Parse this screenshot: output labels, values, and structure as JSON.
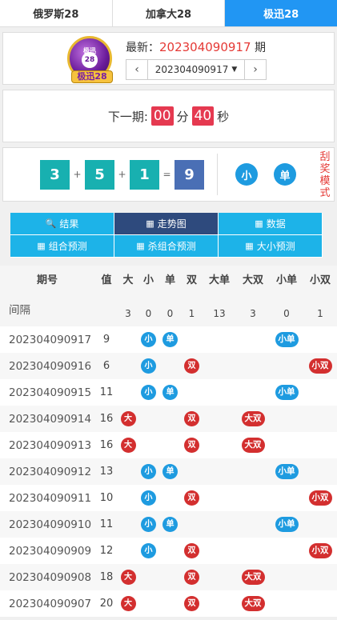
{
  "tabs": [
    "俄罗斯28",
    "加拿大28",
    "极迅28"
  ],
  "logo": {
    "top": "极迅",
    "ball": "28",
    "banner": "极迅28"
  },
  "latest": {
    "prefix": "最新：",
    "issue": "202304090917",
    "suffix": " 期"
  },
  "pager": {
    "prev": "‹",
    "selected": "202304090917",
    "next": "›"
  },
  "countdown": {
    "label": "下一期:",
    "minutes": "00",
    "min_unit": "分",
    "seconds": "40",
    "sec_unit": "秒"
  },
  "result": {
    "n1": "3",
    "n2": "5",
    "n3": "1",
    "plus": "+",
    "eq": "=",
    "sum": "9",
    "size": "小",
    "parity": "单",
    "side": "刮奖模式"
  },
  "buttons": [
    {
      "icon": "🔍",
      "label": "结果"
    },
    {
      "icon": "▦",
      "label": "走势图"
    },
    {
      "icon": "▦",
      "label": "数据"
    },
    {
      "icon": "▦",
      "label": "组合预测"
    },
    {
      "icon": "▦",
      "label": "杀组合预测"
    },
    {
      "icon": "▦",
      "label": "大小预测"
    }
  ],
  "table": {
    "headers": [
      "期号",
      "值",
      "大",
      "小",
      "单",
      "双",
      "大单",
      "大双",
      "小单",
      "小双"
    ],
    "gap_label": "间隔",
    "gaps": [
      "",
      "3",
      "0",
      "0",
      "1",
      "13",
      "3",
      "0",
      "1"
    ],
    "rows": [
      {
        "issue": "202304090917",
        "value": "9",
        "marks": [
          "",
          "小",
          "单",
          "",
          "",
          "",
          "小单",
          ""
        ]
      },
      {
        "issue": "202304090916",
        "value": "6",
        "marks": [
          "",
          "小",
          "",
          "双",
          "",
          "",
          "",
          "小双"
        ]
      },
      {
        "issue": "202304090915",
        "value": "11",
        "marks": [
          "",
          "小",
          "单",
          "",
          "",
          "",
          "小单",
          ""
        ]
      },
      {
        "issue": "202304090914",
        "value": "16",
        "marks": [
          "大",
          "",
          "",
          "双",
          "",
          "大双",
          "",
          ""
        ]
      },
      {
        "issue": "202304090913",
        "value": "16",
        "marks": [
          "大",
          "",
          "",
          "双",
          "",
          "大双",
          "",
          ""
        ]
      },
      {
        "issue": "202304090912",
        "value": "13",
        "marks": [
          "",
          "小",
          "单",
          "",
          "",
          "",
          "小单",
          ""
        ]
      },
      {
        "issue": "202304090911",
        "value": "10",
        "marks": [
          "",
          "小",
          "",
          "双",
          "",
          "",
          "",
          "小双"
        ]
      },
      {
        "issue": "202304090910",
        "value": "11",
        "marks": [
          "",
          "小",
          "单",
          "",
          "",
          "",
          "小单",
          ""
        ]
      },
      {
        "issue": "202304090909",
        "value": "12",
        "marks": [
          "",
          "小",
          "",
          "双",
          "",
          "",
          "",
          "小双"
        ]
      },
      {
        "issue": "202304090908",
        "value": "18",
        "marks": [
          "大",
          "",
          "",
          "双",
          "",
          "大双",
          "",
          ""
        ]
      },
      {
        "issue": "202304090907",
        "value": "20",
        "marks": [
          "大",
          "",
          "",
          "双",
          "",
          "大双",
          "",
          ""
        ]
      }
    ]
  },
  "colors": {
    "accent": "#2196f3",
    "cyan": "#1db3e8",
    "active_btn": "#2e4a7d",
    "red": "#d32f2f",
    "ball_teal": "#18b0b0",
    "sum": "#4a6fb5"
  }
}
